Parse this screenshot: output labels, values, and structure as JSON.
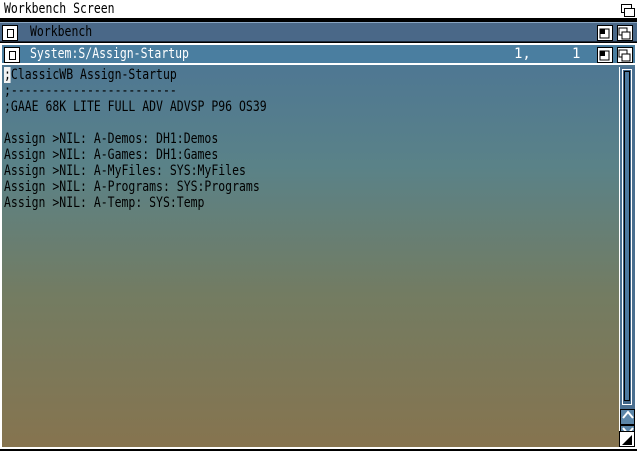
{
  "screen": {
    "title": "Workbench Screen"
  },
  "workbench_window": {
    "title": "Workbench"
  },
  "editor_window": {
    "title": "System:S/Assign-Startup",
    "line_number": "1,",
    "column_number": "1"
  },
  "document": {
    "lines": [
      ";ClassicWB Assign-Startup",
      ";------------------------",
      ";GAAE 68K LITE FULL ADV ADVSP P96 OS39",
      "",
      "Assign >NIL: A-Demos: DH1:Demos",
      "Assign >NIL: A-Games: DH1:Games",
      "Assign >NIL: A-MyFiles: SYS:MyFiles",
      "Assign >NIL: A-Programs: SYS:Programs",
      "Assign >NIL: A-Temp: SYS:Temp"
    ]
  },
  "icons": {
    "close": "close-icon",
    "depth": "depth-arrange-icon",
    "zoom": "zoom-icon",
    "scroll_up": "up-arrow-icon",
    "scroll_down": "down-arrow-icon",
    "resize": "resize-icon"
  },
  "colors": {
    "screen_bar": "#ffffff",
    "active_title": "#4a7ea0",
    "gradient_top": "#4c7595",
    "gradient_bottom": "#86744f",
    "text": "#000000"
  }
}
